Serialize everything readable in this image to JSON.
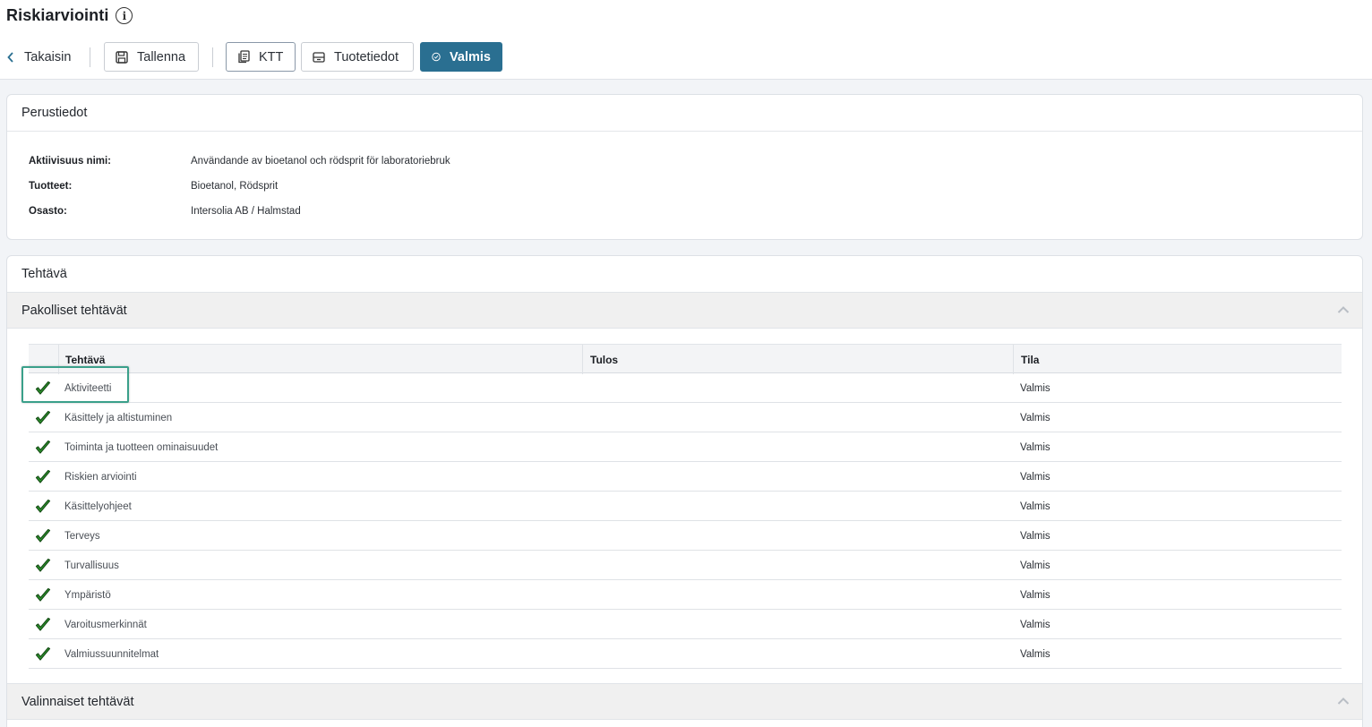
{
  "page": {
    "title": "Riskiarviointi",
    "info_icon": "info-icon"
  },
  "toolbar": {
    "back_label": "Takaisin",
    "save_label": "Tallenna",
    "ktt_label": "KTT",
    "tuotetiedot_label": "Tuotetiedot",
    "valmis_label": "Valmis",
    "accent_color": "#2a6f91"
  },
  "perustiedot": {
    "header": "Perustiedot",
    "fields": [
      {
        "label": "Aktiivisuus nimi:",
        "value": "Användande av bioetanol och rödsprit för laboratoriebruk"
      },
      {
        "label": "Tuotteet:",
        "value": "Bioetanol, Rödsprit"
      },
      {
        "label": "Osasto:",
        "value": "Intersolia AB / Halmstad"
      }
    ]
  },
  "tehtava": {
    "title": "Tehtävä",
    "mandatory_header": "Pakolliset tehtävät",
    "optional_header": "Valinnaiset tehtävät",
    "columns": {
      "task": "Tehtävä",
      "result": "Tulos",
      "status": "Tila"
    },
    "rows": [
      {
        "name": "Aktiviteetti",
        "result": "",
        "status": "Valmis"
      },
      {
        "name": "Käsittely ja altistuminen",
        "result": "",
        "status": "Valmis"
      },
      {
        "name": "Toiminta ja tuotteen ominaisuudet",
        "result": "",
        "status": "Valmis"
      },
      {
        "name": "Riskien arviointi",
        "result": "",
        "status": "Valmis"
      },
      {
        "name": "Käsittelyohjeet",
        "result": "",
        "status": "Valmis"
      },
      {
        "name": "Terveys",
        "result": "",
        "status": "Valmis"
      },
      {
        "name": "Turvallisuus",
        "result": "",
        "status": "Valmis"
      },
      {
        "name": "Ympäristö",
        "result": "",
        "status": "Valmis"
      },
      {
        "name": "Varoitusmerkinnät",
        "result": "",
        "status": "Valmis"
      },
      {
        "name": "Valmiussuunnitelmat",
        "result": "",
        "status": "Valmis"
      }
    ],
    "check_color": "#2e9e2e"
  }
}
